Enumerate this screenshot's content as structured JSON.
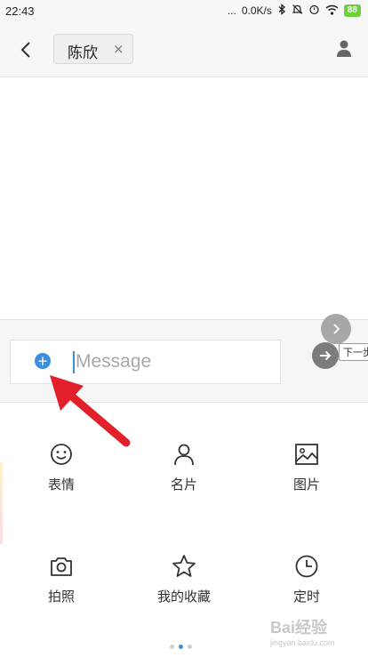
{
  "status_bar": {
    "time": "22:43",
    "dots": "...",
    "speed": "0.0K/s",
    "battery": "88"
  },
  "header": {
    "recipient_name": "陈欣",
    "remove_symbol": "×"
  },
  "composer": {
    "placeholder": "Message",
    "plus_symbol": "+"
  },
  "next_tooltip": "下一步",
  "attachments": [
    {
      "label": "表情",
      "icon": "smiley-icon"
    },
    {
      "label": "名片",
      "icon": "contact-card-icon"
    },
    {
      "label": "图片",
      "icon": "picture-icon"
    },
    {
      "label": "拍照",
      "icon": "camera-icon"
    },
    {
      "label": "我的收藏",
      "icon": "star-icon"
    },
    {
      "label": "定时",
      "icon": "clock-icon"
    }
  ],
  "pager": {
    "count": 3,
    "active": 2
  },
  "watermark": {
    "brand": "Bai经验",
    "url": "jingyan.baidu.com"
  },
  "colors": {
    "accent": "#3a8fdf",
    "annotation_arrow": "#e2202a",
    "battery": "#6ccf3b"
  }
}
